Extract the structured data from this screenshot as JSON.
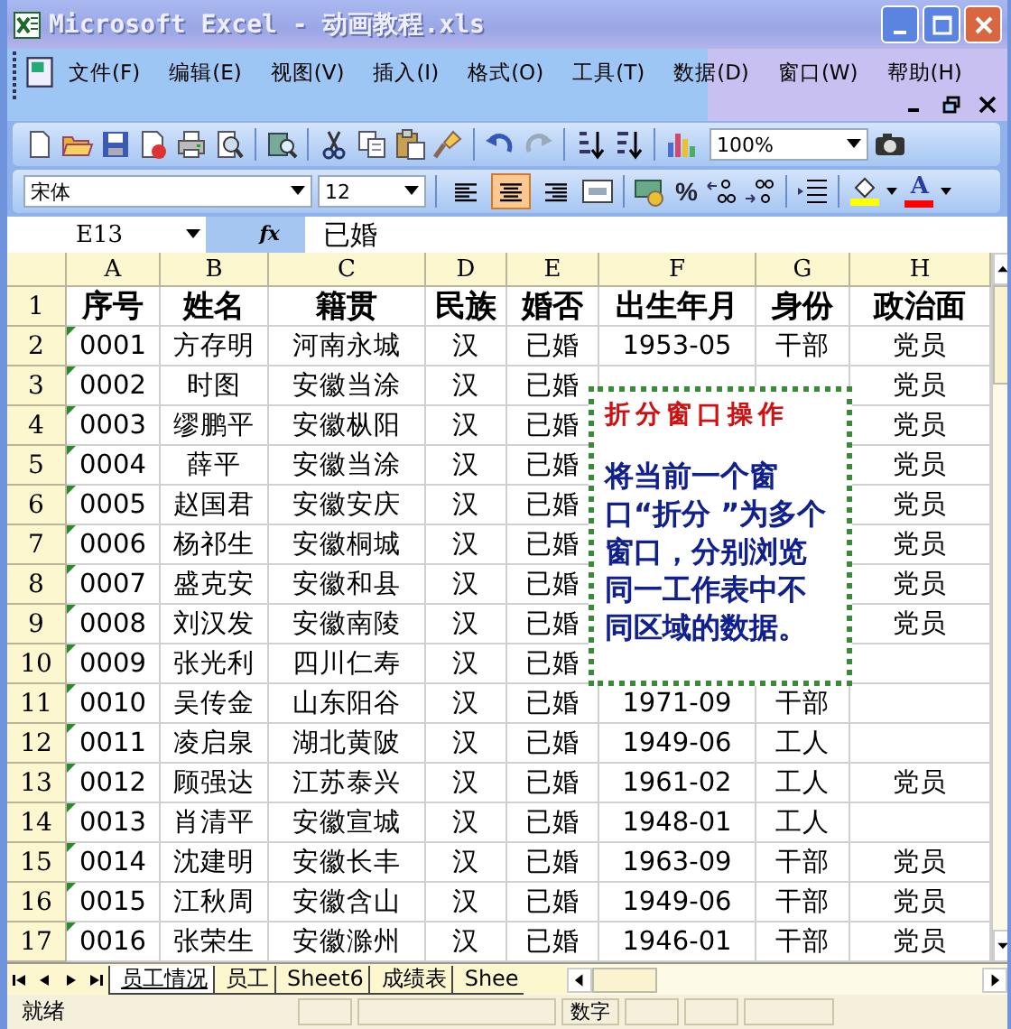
{
  "window": {
    "title": "Microsoft Excel - 动画教程.xls"
  },
  "menu": [
    "文件(F)",
    "编辑(E)",
    "视图(V)",
    "插入(I)",
    "格式(O)",
    "工具(T)",
    "数据(D)",
    "窗口(W)",
    "帮助(H)"
  ],
  "toolbar": {
    "zoom": "100%"
  },
  "format_bar": {
    "font": "宋体",
    "size": "12",
    "percent": "%",
    "font_color_label": "A",
    "align_buttons": [
      {
        "kind": "left",
        "selected": false
      },
      {
        "kind": "center",
        "selected": true
      },
      {
        "kind": "right",
        "selected": false
      }
    ]
  },
  "formula_bar": {
    "cell": "E13",
    "fx": "fx",
    "value": "已婚"
  },
  "columns": [
    "A",
    "B",
    "C",
    "D",
    "E",
    "F",
    "G",
    "H"
  ],
  "rows": [
    {
      "number": "1",
      "kind": "heading",
      "cells": [
        "序号",
        "姓名",
        "籍贯",
        "民族",
        "婚否",
        "出生年月",
        "身份",
        "政治面"
      ]
    },
    {
      "number": "2",
      "kind": "data",
      "cells": [
        "0001",
        "方存明",
        "河南永城",
        "汉",
        "已婚",
        "1953-05",
        "干部",
        "党员"
      ]
    },
    {
      "number": "3",
      "kind": "data",
      "cells": [
        "0002",
        "时图",
        "安徽当涂",
        "汉",
        "已婚",
        null,
        null,
        "党员"
      ]
    },
    {
      "number": "4",
      "kind": "data",
      "cells": [
        "0003",
        "缪鹏平",
        "安徽枞阳",
        "汉",
        "已婚",
        null,
        null,
        "党员"
      ]
    },
    {
      "number": "5",
      "kind": "data",
      "cells": [
        "0004",
        "薛平",
        "安徽当涂",
        "汉",
        "已婚",
        null,
        null,
        "党员"
      ]
    },
    {
      "number": "6",
      "kind": "data",
      "cells": [
        "0005",
        "赵国君",
        "安徽安庆",
        "汉",
        "已婚",
        null,
        null,
        "党员"
      ]
    },
    {
      "number": "7",
      "kind": "data",
      "cells": [
        "0006",
        "杨祁生",
        "安徽桐城",
        "汉",
        "已婚",
        null,
        null,
        "党员"
      ]
    },
    {
      "number": "8",
      "kind": "data",
      "cells": [
        "0007",
        "盛克安",
        "安徽和县",
        "汉",
        "已婚",
        null,
        null,
        "党员"
      ]
    },
    {
      "number": "9",
      "kind": "data",
      "cells": [
        "0008",
        "刘汉发",
        "安徽南陵",
        "汉",
        "已婚",
        null,
        null,
        "党员"
      ]
    },
    {
      "number": "10",
      "kind": "data",
      "cells": [
        "0009",
        "张光利",
        "四川仁寿",
        "汉",
        "已婚",
        null,
        null,
        null
      ]
    },
    {
      "number": "11",
      "kind": "data",
      "cells": [
        "0010",
        "吴传金",
        "山东阳谷",
        "汉",
        "已婚",
        "1971-09",
        "干部",
        null
      ]
    },
    {
      "number": "12",
      "kind": "data",
      "cells": [
        "0011",
        "凌启泉",
        "湖北黄陂",
        "汉",
        "已婚",
        "1949-06",
        "工人",
        null
      ]
    },
    {
      "number": "13",
      "kind": "data",
      "cells": [
        "0012",
        "顾强达",
        "江苏泰兴",
        "汉",
        "已婚",
        "1961-02",
        "工人",
        "党员"
      ]
    },
    {
      "number": "14",
      "kind": "data",
      "cells": [
        "0013",
        "肖清平",
        "安徽宣城",
        "汉",
        "已婚",
        "1948-01",
        "工人",
        null
      ]
    },
    {
      "number": "15",
      "kind": "data",
      "cells": [
        "0014",
        "沈建明",
        "安徽长丰",
        "汉",
        "已婚",
        "1963-09",
        "干部",
        "党员"
      ]
    },
    {
      "number": "16",
      "kind": "data",
      "cells": [
        "0015",
        "江秋周",
        "安徽含山",
        "汉",
        "已婚",
        "1949-06",
        "干部",
        "党员"
      ]
    },
    {
      "number": "17",
      "kind": "data",
      "cells": [
        "0016",
        "张荣生",
        "安徽滁州",
        "汉",
        "已婚",
        "1946-01",
        "干部",
        "党员"
      ]
    }
  ],
  "callout": {
    "title": "折分窗口操作",
    "text": "将当前一个窗口“折分 ”为多个窗口，分别浏览同一工作表中不同区域的数据。"
  },
  "sheet_tabs": [
    {
      "label": "员工情况",
      "selected": true
    },
    {
      "label": "员工",
      "selected": false
    },
    {
      "label": "Sheet6",
      "selected": false
    },
    {
      "label": "成绩表",
      "selected": false
    },
    {
      "label": "Shee",
      "selected": false
    }
  ],
  "status_bar": {
    "text": "就绪",
    "indicator": "数字"
  }
}
